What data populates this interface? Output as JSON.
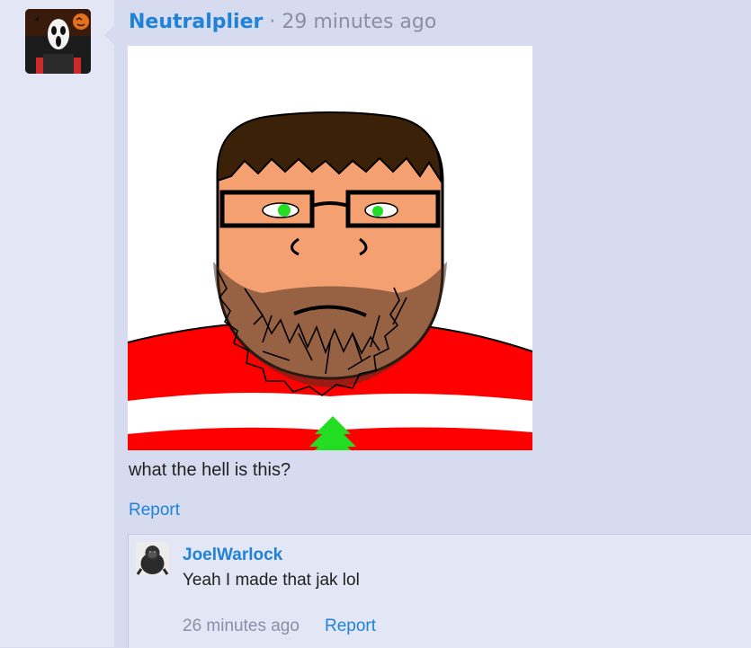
{
  "post": {
    "username": "Neutralplier",
    "separator": "·",
    "timestamp": "29 minutes ago",
    "avatar_icon": "ghostface-mask-avatar",
    "image_icon": "drawn-bearded-man-with-glasses",
    "body": "what the hell is this?",
    "report_label": "Report"
  },
  "reply": {
    "username": "JoelWarlock",
    "avatar_icon": "gorilla-avatar",
    "body": "Yeah I made that jak lol",
    "timestamp": "26 minutes ago",
    "report_label": "Report"
  },
  "colors": {
    "link": "#1e82d9",
    "meta_text": "#8a8fa6",
    "page_bg": "#d7dbef",
    "rail_bg": "#e3e6f4"
  }
}
